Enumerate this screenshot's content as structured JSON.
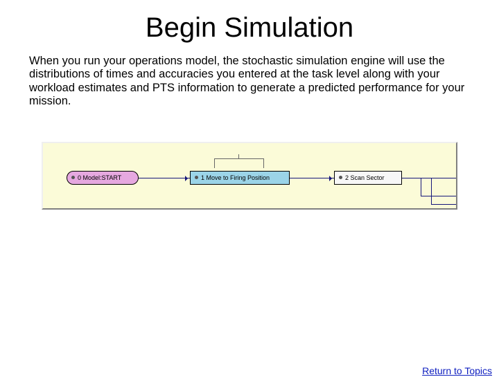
{
  "title": "Begin Simulation",
  "body": "When you run your operations model, the stochastic simulation engine will use the distributions of times and accuracies you entered at the task level along with your workload estimates and PTS information to generate a predicted performance for your mission.",
  "diagram": {
    "nodes": {
      "start": "0 Model:START",
      "move": "1 Move to Firing Position",
      "scan": "2 Scan Sector"
    }
  },
  "footer": {
    "return_link": "Return to Topics"
  }
}
